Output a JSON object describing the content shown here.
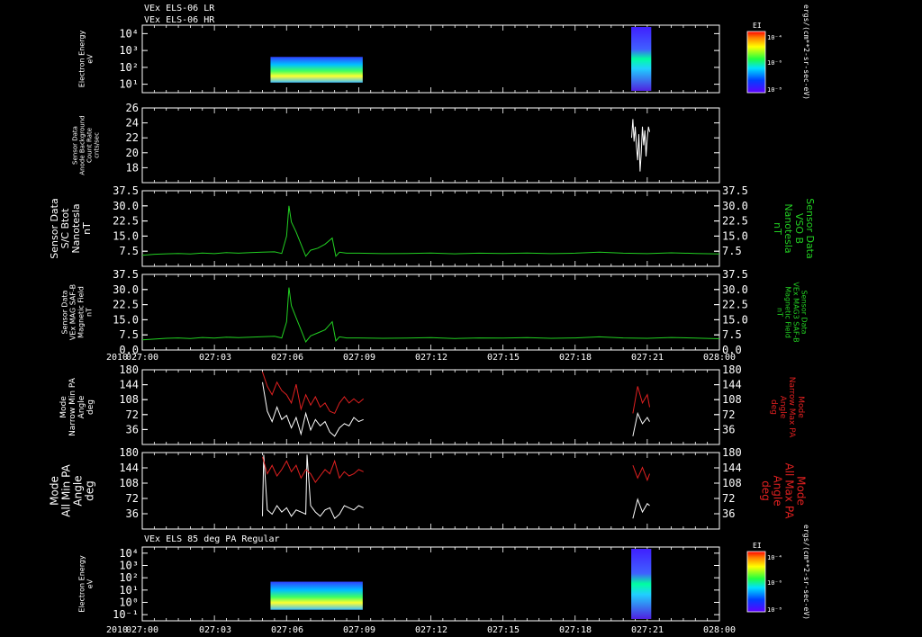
{
  "colors": {
    "background": "#000000",
    "axis": "#ffffff",
    "green": "#22d022",
    "red": "#e02020",
    "white": "#ffffff"
  },
  "header": {
    "line1": "VEx ELS-06 LR",
    "line2": "VEx ELS-06 HR"
  },
  "bottom_header": "VEx ELS 85 deg PA Regular",
  "time_axis": {
    "year": "2010",
    "ticks": [
      "027:00",
      "027:03",
      "027:06",
      "027:09",
      "027:12",
      "027:15",
      "027:18",
      "027:21",
      "028:00"
    ]
  },
  "colorbar": {
    "label": "EI",
    "ticks": [
      "10⁻⁴",
      "10⁻⁶",
      "10⁻⁸"
    ],
    "unit": "ergs/(cm**2-sr-sec-eV)"
  },
  "chart_data": [
    {
      "type": "heatmap",
      "panel": "energy-top",
      "ylabel": [
        "Electron Energy",
        "eV"
      ],
      "y_ticks": [
        "10⁴",
        "10³",
        "10²",
        "10¹"
      ],
      "data_intervals": [
        [
          "027:05:20",
          "027:09:10"
        ],
        [
          "027:20:20",
          "027:21:10"
        ]
      ]
    },
    {
      "type": "line",
      "panel": "background",
      "ylabel": [
        "Sensor Data",
        "Anode Background",
        "Count Rate",
        "cnts/sec"
      ],
      "ylim": [
        16,
        26
      ],
      "y_ticks": [
        "26",
        "24",
        "22",
        "20",
        "18"
      ],
      "series": [
        {
          "color": "white",
          "x_hours": [
            20.35,
            20.4,
            20.45,
            20.5,
            20.55,
            20.6,
            20.65,
            20.7,
            20.75,
            20.8,
            20.85,
            20.9,
            20.95,
            21.0,
            21.05,
            21.1
          ],
          "values": [
            22,
            24.5,
            21.5,
            23.5,
            20.8,
            19,
            22.5,
            17.5,
            20,
            23.5,
            21,
            23,
            19.5,
            22,
            23.5,
            22.8
          ]
        }
      ]
    },
    {
      "type": "line",
      "panel": "vso-b",
      "ylabel_left": [
        "Sensor Data",
        "S/C Btot",
        "Nanotesla",
        "nT"
      ],
      "ylabel_right": [
        "Sensor Data",
        "VSO B",
        "Nanotesla",
        "nT"
      ],
      "ylim": [
        0,
        37.5
      ],
      "y_ticks": [
        "37.5",
        "30.0",
        "22.5",
        "15.0",
        "7.5"
      ],
      "series": [
        {
          "color": "green",
          "x_hours": [
            0,
            0.5,
            1,
            1.5,
            2,
            2.5,
            3,
            3.5,
            4,
            4.5,
            5,
            5.5,
            5.8,
            6.0,
            6.1,
            6.2,
            6.4,
            6.6,
            6.8,
            7.0,
            7.3,
            7.6,
            7.9,
            8.05,
            8.2,
            8.5,
            9,
            10,
            11,
            12,
            13,
            14,
            15,
            16,
            17,
            18,
            19,
            20,
            21,
            22,
            23,
            24
          ],
          "values": [
            5.5,
            6.0,
            6.2,
            6.4,
            6.1,
            6.6,
            6.3,
            6.8,
            6.5,
            6.8,
            7.0,
            7.2,
            6.4,
            15,
            30,
            22,
            17,
            11,
            5,
            8,
            9,
            11,
            14,
            5,
            7,
            6.5,
            6.5,
            6.3,
            6.4,
            6.6,
            6.2,
            6.5,
            6.4,
            6.6,
            6.3,
            6.5,
            7.0,
            6.5,
            6.3,
            6.7,
            6.4,
            6.1
          ]
        }
      ]
    },
    {
      "type": "line",
      "panel": "mag-saf-b",
      "ylabel_left": [
        "Sensor Data",
        "VEx MAG SAF-B",
        "Magnetic Field",
        "nT"
      ],
      "ylabel_right": [
        "Sensor Data",
        "VEx MAG3 SAF-B",
        "Magnetic Field",
        "nT"
      ],
      "ylim": [
        0,
        37.5
      ],
      "y_ticks": [
        "37.5",
        "30.0",
        "22.5",
        "15.0",
        "7.5",
        "0.0"
      ],
      "series": [
        {
          "color": "green",
          "x_hours": [
            0,
            0.5,
            1,
            1.5,
            2,
            2.5,
            3,
            3.5,
            4,
            4.5,
            5,
            5.5,
            5.8,
            6.0,
            6.1,
            6.2,
            6.4,
            6.6,
            6.8,
            7.0,
            7.3,
            7.6,
            7.9,
            8.05,
            8.2,
            8.5,
            9,
            10,
            11,
            12,
            13,
            14,
            15,
            16,
            17,
            18,
            19,
            20,
            21,
            22,
            23,
            24
          ],
          "values": [
            5.0,
            5.4,
            5.8,
            6.0,
            5.7,
            6.2,
            5.9,
            6.4,
            6.1,
            6.4,
            6.6,
            6.8,
            6.0,
            14,
            31,
            22,
            16,
            10,
            4,
            7,
            8.5,
            10,
            14,
            4.5,
            6.5,
            6,
            6,
            5.8,
            5.9,
            6.1,
            5.7,
            6,
            5.9,
            6.1,
            5.8,
            6,
            6.5,
            6,
            5.8,
            6.2,
            5.9,
            5.6
          ]
        }
      ]
    },
    {
      "type": "line",
      "panel": "narrow-pa",
      "ylabel_left": [
        "Mode",
        "Narrow Min PA",
        "Angle",
        "deg"
      ],
      "ylabel_right": [
        "Mode",
        "Narrow Max PA",
        "Angle",
        "deg"
      ],
      "ylim": [
        0,
        180
      ],
      "y_ticks": [
        "180",
        "144",
        "108",
        "72",
        "36"
      ],
      "series": [
        {
          "name": "min",
          "color": "white",
          "x_hours": [
            5.0,
            5.2,
            5.4,
            5.6,
            5.8,
            6.0,
            6.2,
            6.4,
            6.6,
            6.8,
            7.0,
            7.2,
            7.4,
            7.6,
            7.8,
            8.0,
            8.2,
            8.4,
            8.6,
            8.8,
            9.0,
            9.2,
            20.4,
            20.6,
            20.8,
            21.0,
            21.1
          ],
          "values": [
            150,
            80,
            55,
            90,
            60,
            70,
            40,
            65,
            25,
            75,
            35,
            60,
            45,
            55,
            30,
            20,
            40,
            50,
            45,
            65,
            55,
            60,
            20,
            75,
            50,
            65,
            55
          ]
        },
        {
          "name": "max",
          "color": "red",
          "x_hours": [
            5.0,
            5.2,
            5.4,
            5.6,
            5.8,
            6.0,
            6.2,
            6.4,
            6.6,
            6.8,
            7.0,
            7.2,
            7.4,
            7.6,
            7.8,
            8.0,
            8.2,
            8.4,
            8.6,
            8.8,
            9.0,
            9.2,
            20.4,
            20.6,
            20.8,
            21.0,
            21.1
          ],
          "values": [
            175,
            140,
            120,
            150,
            130,
            120,
            100,
            145,
            85,
            120,
            95,
            115,
            90,
            100,
            80,
            75,
            100,
            115,
            100,
            110,
            100,
            110,
            75,
            140,
            100,
            120,
            90
          ]
        }
      ]
    },
    {
      "type": "line",
      "panel": "all-pa",
      "ylabel_left": [
        "Mode",
        "All Min PA",
        "Angle",
        "deg"
      ],
      "ylabel_right": [
        "Mode",
        "All Max PA",
        "Angle",
        "deg"
      ],
      "ylim": [
        0,
        180
      ],
      "y_ticks": [
        "180",
        "144",
        "108",
        "72",
        "36"
      ],
      "series": [
        {
          "name": "min",
          "color": "white",
          "x_hours": [
            5.0,
            5.05,
            5.2,
            5.4,
            5.6,
            5.8,
            6.0,
            6.2,
            6.4,
            6.6,
            6.8,
            6.85,
            7.0,
            7.2,
            7.4,
            7.6,
            7.8,
            8.0,
            8.2,
            8.4,
            8.6,
            8.8,
            9.0,
            9.2,
            20.4,
            20.6,
            20.8,
            21.0,
            21.1
          ],
          "values": [
            30,
            175,
            45,
            35,
            55,
            40,
            50,
            30,
            45,
            40,
            35,
            175,
            55,
            40,
            30,
            45,
            50,
            25,
            35,
            55,
            50,
            45,
            55,
            50,
            25,
            70,
            40,
            60,
            55
          ]
        },
        {
          "name": "max",
          "color": "red",
          "x_hours": [
            5.0,
            5.2,
            5.4,
            5.6,
            5.8,
            6.0,
            6.2,
            6.4,
            6.6,
            6.8,
            7.0,
            7.2,
            7.4,
            7.6,
            7.8,
            8.0,
            8.2,
            8.4,
            8.6,
            8.8,
            9.0,
            9.2,
            20.4,
            20.6,
            20.8,
            21.0,
            21.1
          ],
          "values": [
            170,
            130,
            150,
            125,
            140,
            160,
            135,
            150,
            120,
            140,
            130,
            110,
            125,
            140,
            130,
            160,
            120,
            135,
            125,
            130,
            140,
            135,
            150,
            120,
            145,
            115,
            130
          ]
        }
      ]
    },
    {
      "type": "heatmap",
      "panel": "energy-bottom",
      "ylabel": [
        "Electron Energy",
        "eV"
      ],
      "y_ticks": [
        "10⁴",
        "10³",
        "10²",
        "10¹",
        "10⁰",
        "10⁻¹"
      ],
      "data_intervals": [
        [
          "027:05:20",
          "027:09:10"
        ],
        [
          "027:20:20",
          "027:21:10"
        ]
      ]
    }
  ]
}
